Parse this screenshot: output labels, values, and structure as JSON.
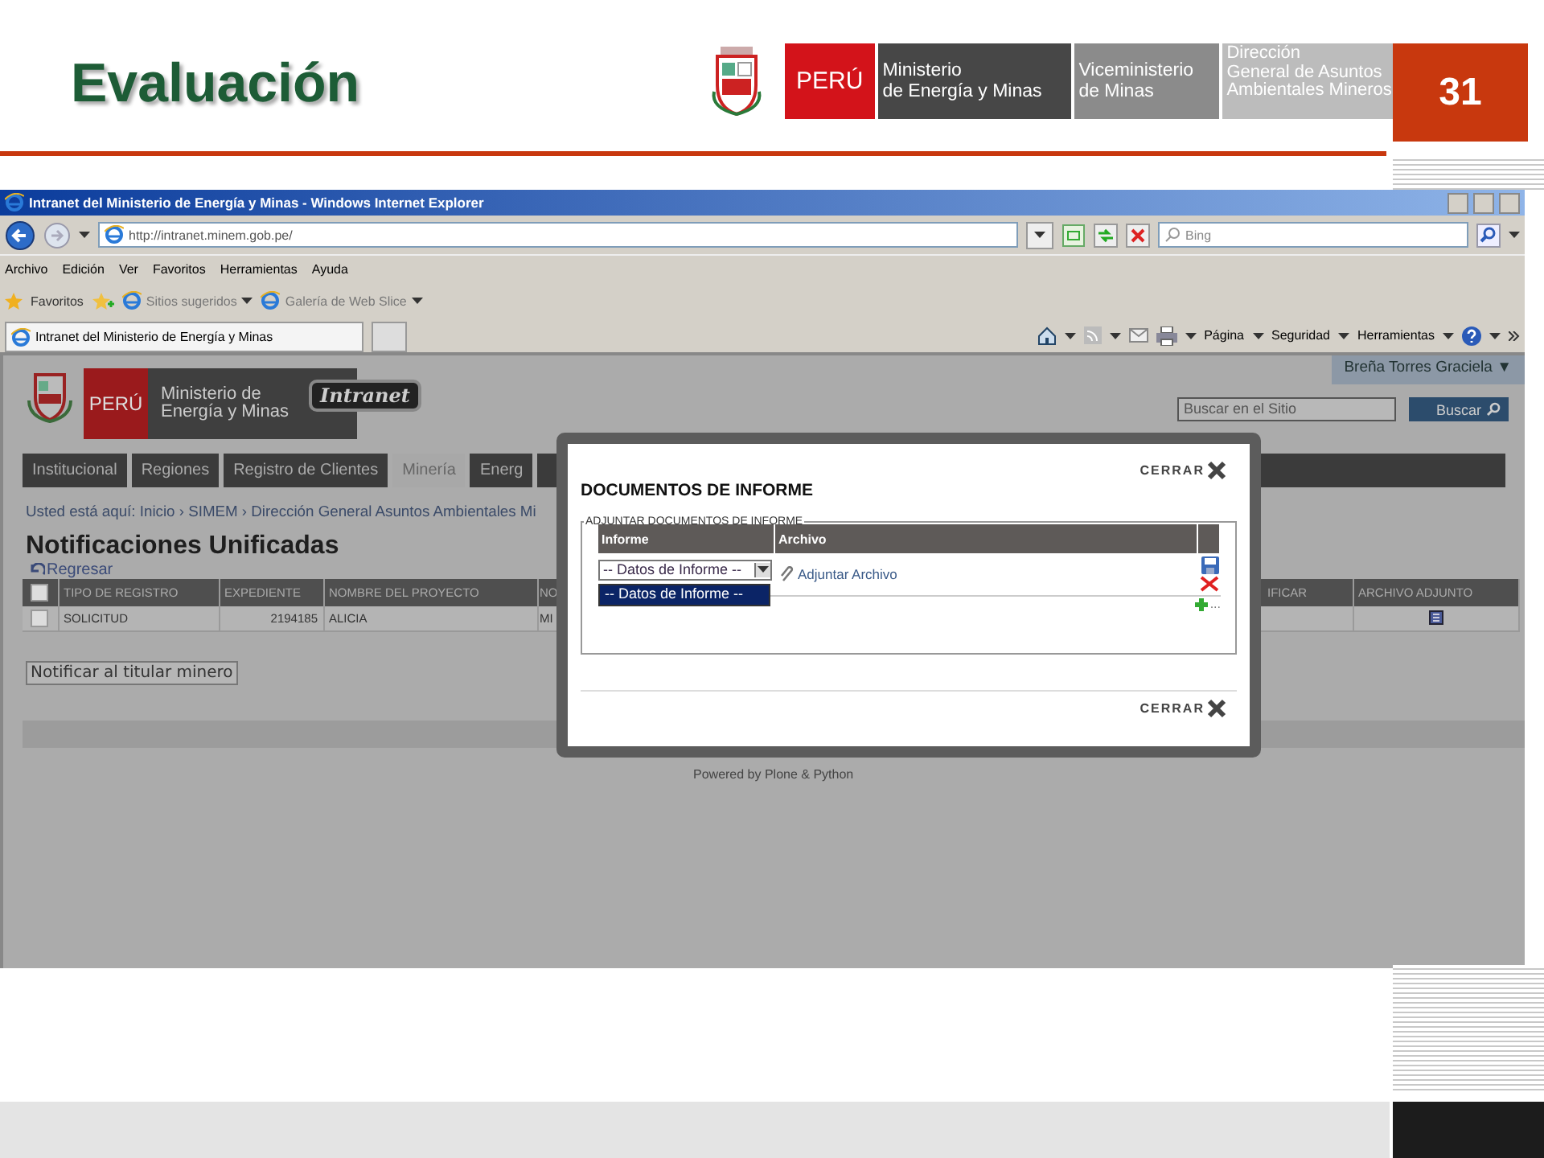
{
  "slide": {
    "title": "Evaluación",
    "number": "31",
    "logos": {
      "country": "PERÚ",
      "ministry": "Ministerio\nde Energía y Minas",
      "vice": "Viceministerio\nde Minas",
      "direction": "Dirección\nGeneral de Asuntos\nAmbientales Mineros"
    }
  },
  "browser": {
    "title": "Intranet del Ministerio de Energía y Minas - Windows Internet Explorer",
    "address": "http://intranet.minem.gob.pe/",
    "search": {
      "placeholder": "Bing"
    },
    "menu": [
      "Archivo",
      "Edición",
      "Ver",
      "Favoritos",
      "Herramientas",
      "Ayuda"
    ],
    "favorites": {
      "label": "Favoritos",
      "items": [
        "Sitios sugeridos",
        "Galería de Web Slice"
      ]
    },
    "tab": "Intranet del Ministerio de Energía y Minas",
    "commands": [
      "Página",
      "Seguridad",
      "Herramientas"
    ]
  },
  "page": {
    "logo": {
      "country": "PERÚ",
      "ministry": "Ministerio de\nEnergía y Minas",
      "badge": "Intranet"
    },
    "user": "Breña Torres Graciela ▼",
    "search": {
      "placeholder": "Buscar en el Sitio",
      "button": "Buscar"
    },
    "nav": [
      {
        "label": "Institucional",
        "selected": false
      },
      {
        "label": "Regiones",
        "selected": false
      },
      {
        "label": "Registro de Clientes",
        "selected": false
      },
      {
        "label": "Minería",
        "selected": true
      },
      {
        "label": "Energ",
        "selected": false
      }
    ],
    "breadcrumb": "Usted está aquí: Inicio › SIMEM › Dirección General Asuntos Ambientales Mi",
    "heading": "Notificaciones Unificadas",
    "back": "Regresar",
    "table": {
      "select_all_checked": false,
      "columns": [
        "TIPO DE REGISTRO",
        "EXPEDIENTE",
        "NOMBRE DEL PROYECTO",
        "NO",
        "IFICAR",
        "ARCHIVO ADJUNTO"
      ],
      "rows": [
        {
          "checked": false,
          "cells": [
            "SOLICITUD",
            "2194185",
            "ALICIA",
            "MI"
          ]
        }
      ]
    },
    "notify_button": "Notificar al titular minero",
    "footer": "Powered by Plone & Python"
  },
  "modal": {
    "close_top": "CERRAR",
    "title": "DOCUMENTOS DE INFORME",
    "legend": "ADJUNTAR DOCUMENTOS DE INFORME",
    "columns": [
      "Informe",
      "Archivo"
    ],
    "select": {
      "value": "-- Datos de Informe --",
      "options": [
        {
          "label": "-- Datos de Informe --",
          "selected": true
        }
      ]
    },
    "link": "Adjuntar Archivo",
    "more": "...",
    "close_bottom": "CERRAR"
  }
}
